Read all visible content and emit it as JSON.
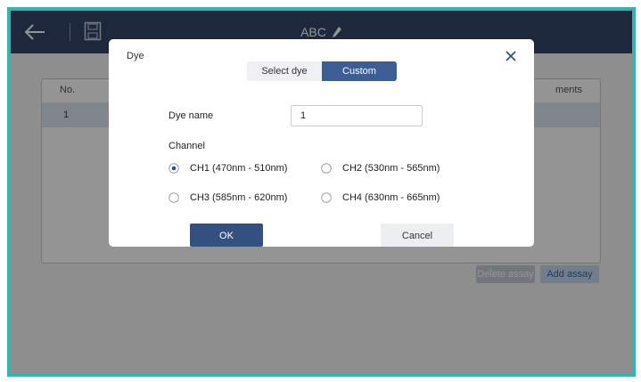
{
  "header": {
    "title": "ABC",
    "back_icon": "arrow-left-icon",
    "save_icon": "save-icon",
    "edit_icon": "pencil-icon",
    "background": "#34466a"
  },
  "table": {
    "columns": [
      "No.",
      "ments"
    ],
    "rows": [
      {
        "no": "1"
      }
    ]
  },
  "actions": {
    "delete_label": "Delete assay",
    "add_label": "Add assay"
  },
  "dialog": {
    "title": "Dye",
    "close_icon": "close-icon",
    "tabs": [
      {
        "label": "Select dye",
        "active": false
      },
      {
        "label": "Custom",
        "active": true
      }
    ],
    "dye_name_label": "Dye name",
    "dye_name_value": "1",
    "channel_label": "Channel",
    "channels": [
      {
        "label": "CH1 (470nm - 510nm)",
        "selected": true
      },
      {
        "label": "CH2 (530nm - 565nm)",
        "selected": false
      },
      {
        "label": "CH3 (585nm - 620nm)",
        "selected": false
      },
      {
        "label": "CH4 (630nm - 665nm)",
        "selected": false
      }
    ],
    "ok_label": "OK",
    "cancel_label": "Cancel"
  },
  "colors": {
    "frame_border": "#2fb6b1",
    "accent": "#3d5e94",
    "ok_button": "#34507f"
  }
}
